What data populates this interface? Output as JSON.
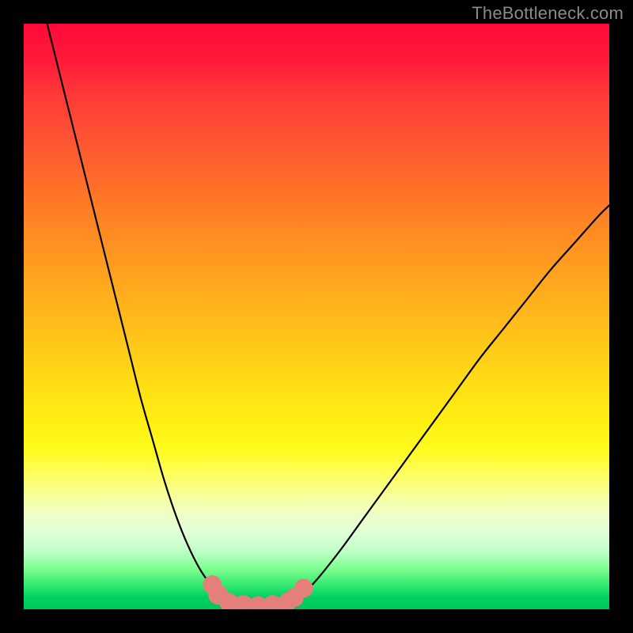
{
  "watermark": "TheBottleneck.com",
  "chart_data": {
    "type": "line",
    "title": "",
    "xlabel": "",
    "ylabel": "",
    "xlim": [
      0,
      100
    ],
    "ylim": [
      0,
      100
    ],
    "grid": false,
    "legend": false,
    "series": [
      {
        "name": "left-branch",
        "x": [
          4,
          6,
          8,
          10,
          12,
          14,
          16,
          18,
          20,
          22,
          24,
          26,
          28,
          30,
          32,
          33,
          34,
          35
        ],
        "y": [
          100,
          92,
          84,
          76,
          68,
          60,
          52,
          44,
          36,
          29,
          22,
          16,
          11,
          7,
          4,
          2.5,
          1.5,
          1
        ],
        "color": "#000000"
      },
      {
        "name": "valley-floor",
        "x": [
          35,
          40,
          45
        ],
        "y": [
          1,
          0.5,
          1
        ],
        "color": "#000000"
      },
      {
        "name": "right-branch",
        "x": [
          45,
          46,
          48,
          50,
          54,
          58,
          62,
          66,
          70,
          74,
          78,
          82,
          86,
          90,
          94,
          98,
          100
        ],
        "y": [
          1,
          1.5,
          3,
          5,
          10,
          15.5,
          21,
          26.5,
          32,
          37.5,
          43,
          48,
          53,
          58,
          62.5,
          67,
          69
        ],
        "color": "#000000"
      }
    ],
    "markers": [
      {
        "name": "left-blob-1",
        "x": 32.2,
        "y": 4.2,
        "r": 1.6,
        "color": "#e57f7a"
      },
      {
        "name": "left-blob-2",
        "x": 33.2,
        "y": 2.5,
        "r": 1.7,
        "color": "#e57f7a"
      },
      {
        "name": "left-blob-3",
        "x": 35.0,
        "y": 1.2,
        "r": 1.6,
        "color": "#e57f7a"
      },
      {
        "name": "floor-blob-1",
        "x": 37.5,
        "y": 0.7,
        "r": 1.7,
        "color": "#e57f7a"
      },
      {
        "name": "floor-blob-2",
        "x": 40.0,
        "y": 0.5,
        "r": 1.7,
        "color": "#e57f7a"
      },
      {
        "name": "floor-blob-3",
        "x": 42.5,
        "y": 0.7,
        "r": 1.7,
        "color": "#e57f7a"
      },
      {
        "name": "right-blob-1",
        "x": 45.0,
        "y": 1.2,
        "r": 1.6,
        "color": "#e57f7a"
      },
      {
        "name": "right-blob-2",
        "x": 46.2,
        "y": 2.0,
        "r": 1.6,
        "color": "#e57f7a"
      },
      {
        "name": "right-blob-3",
        "x": 47.8,
        "y": 3.6,
        "r": 1.6,
        "color": "#e57f7a"
      }
    ],
    "background_colors": {
      "top": "#ff0a3a",
      "mid": "#ffd816",
      "bottom": "#00c858"
    }
  }
}
